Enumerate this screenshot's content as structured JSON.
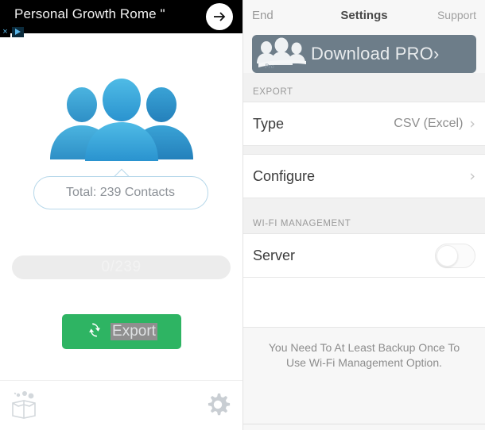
{
  "ad": {
    "text": "Personal Growth Rome \"",
    "arrow_icon": "arrow-right-icon",
    "close_icon": "×",
    "adchoices_icon": "adchoices-icon"
  },
  "left": {
    "people_icon": "three-people-icon",
    "total_bubble": "Total: 239 Contacts",
    "progress_label": "0/239",
    "export_button": "Export",
    "export_icon": "sync-refresh-icon",
    "restore_icon": "restore-box-icon",
    "settings_icon": "gear-icon",
    "accent_green": "#2eb463",
    "accent_blue": "#2e9fd4"
  },
  "right": {
    "nav": {
      "left_label": "End",
      "title": "Settings",
      "right_label": "Support"
    },
    "pro_banner": {
      "label": "Download PRO›",
      "badge": "Pro",
      "icon": "pro-people-icon",
      "bg_color": "#6d7d89"
    },
    "sections": [
      {
        "header": "EXPORT",
        "rows": [
          {
            "label": "Type",
            "value": "CSV (Excel)",
            "accessory": "chevron"
          },
          {
            "label": "Configure",
            "value": "",
            "accessory": "chevron"
          }
        ]
      },
      {
        "header": "WI-FI MANAGEMENT",
        "rows": [
          {
            "label": "Server",
            "value": "",
            "accessory": "toggle-off"
          }
        ]
      }
    ],
    "footer_note": "You Need To At Least Backup Once To Use Wi-Fi Management Option."
  }
}
